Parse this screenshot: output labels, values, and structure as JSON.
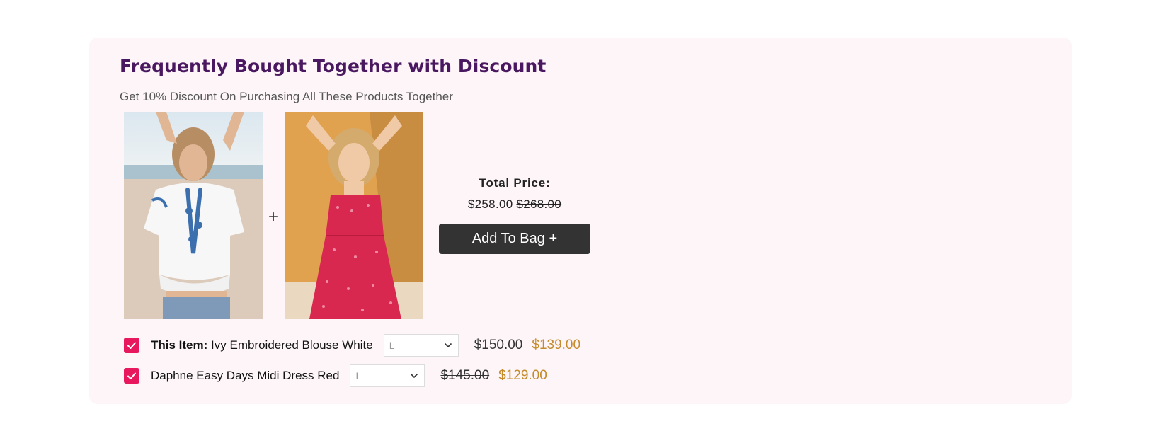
{
  "section": {
    "title": "Frequently Bought Together with Discount",
    "subtitle": "Get 10% Discount On Purchasing All These Products Together"
  },
  "images": [
    {
      "alt": "Ivy Embroidered Blouse White"
    },
    {
      "alt": "Daphne Easy Days Midi Dress Red"
    }
  ],
  "plus_glyph": "+",
  "total": {
    "label": "Total Price:",
    "price": "$258.00",
    "original_price": "$268.00"
  },
  "add_button": "Add To Bag +",
  "items": [
    {
      "prefix": "This Item:",
      "name": "Ivy Embroidered Blouse White",
      "checked": true,
      "size": "L",
      "old_price": "$150.00",
      "new_price": "$139.00"
    },
    {
      "prefix": "",
      "name": "Daphne Easy Days Midi Dress Red",
      "checked": true,
      "size": "L",
      "old_price": "$145.00",
      "new_price": "$129.00"
    }
  ],
  "colors": {
    "panel_bg": "#fdf5f7",
    "title": "#4a1860",
    "checkbox": "#e8185e",
    "button_bg": "#333333",
    "sale_price": "#c58a2a"
  },
  "icons": {
    "checkbox": "check-icon",
    "select": "chevron-down-icon"
  }
}
